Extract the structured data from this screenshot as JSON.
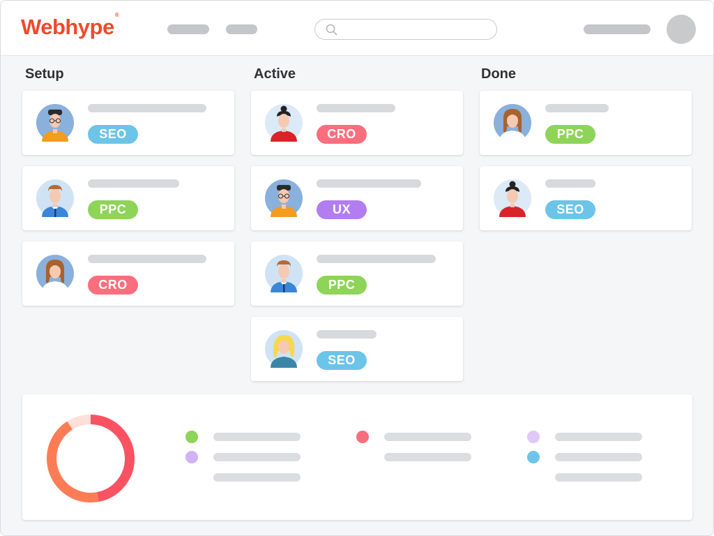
{
  "app": {
    "logo": "Webhype",
    "logo_mark": "®"
  },
  "colors": {
    "SEO": "#6cc4e9",
    "PPC": "#8ed458",
    "CRO": "#fa6e7d",
    "UX": "#b27df0"
  },
  "columns": [
    {
      "title": "Setup",
      "cards": [
        {
          "avatar": "man-curly-glasses-avatar",
          "tag": "SEO"
        },
        {
          "avatar": "man-tie-avatar",
          "tag": "PPC"
        },
        {
          "avatar": "woman-long-hair-avatar",
          "tag": "CRO"
        }
      ]
    },
    {
      "title": "Active",
      "cards": [
        {
          "avatar": "woman-bun-avatar",
          "tag": "CRO"
        },
        {
          "avatar": "man-curly-glasses-avatar",
          "tag": "UX"
        },
        {
          "avatar": "man-tie-avatar",
          "tag": "PPC"
        },
        {
          "avatar": "woman-blonde-avatar",
          "tag": "SEO"
        }
      ]
    },
    {
      "title": "Done",
      "cards": [
        {
          "avatar": "woman-long-hair-avatar",
          "tag": "PPC"
        },
        {
          "avatar": "woman-bun-avatar",
          "tag": "SEO"
        }
      ]
    }
  ],
  "summary": {
    "donut": [
      {
        "color": "#fa5262",
        "share": 0.47
      },
      {
        "color": "#fc7c56",
        "share": 0.44
      },
      {
        "color": "#fde0d8",
        "share": 0.09
      }
    ],
    "legend_dots": [
      {
        "color": "#8ed458"
      },
      {
        "color": "#d2b2f5"
      },
      {
        "color": "#fa6e7d"
      },
      {
        "color": "#e0c8f7"
      },
      {
        "color": "#6cc4e9"
      }
    ]
  }
}
